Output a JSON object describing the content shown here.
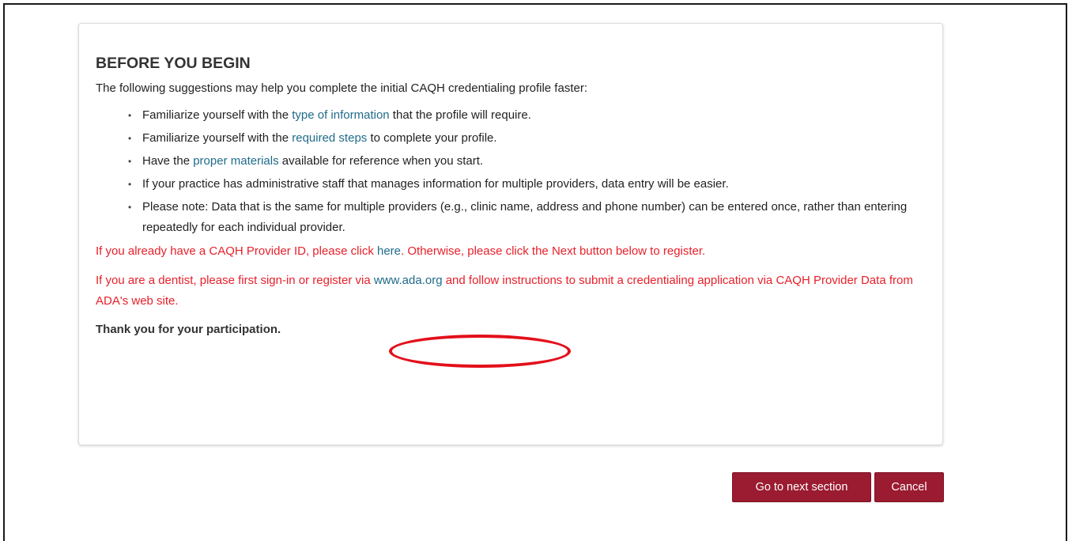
{
  "card": {
    "title": "BEFORE YOU BEGIN",
    "intro": "The following suggestions may help you complete the initial CAQH credentialing profile faster:",
    "tips": [
      {
        "pre": "Familiarize yourself with the ",
        "link": "type of information",
        "post": " that the profile will require."
      },
      {
        "pre": "Familiarize yourself with the ",
        "link": "required steps",
        "post": " to complete your profile."
      },
      {
        "pre": "Have the ",
        "link": "proper materials",
        "post": " available for reference when you start."
      },
      {
        "pre": "If your practice has administrative staff that manages information for multiple providers, data entry will be easier.",
        "link": "",
        "post": ""
      },
      {
        "pre": "Please note: Data that is the same for multiple providers (e.g., clinic name, address and phone number) can be entered once, rather than entering repeatedly for each individual provider.",
        "link": "",
        "post": ""
      }
    ],
    "bullet": "•",
    "provider_id_notice": {
      "pre": "If you already have a CAQH Provider ID, please click ",
      "link": "here",
      "post": ". Otherwise, please click the Next button below to register."
    },
    "dentist_notice": {
      "pre": "If you are a dentist, please first sign-in or register via ",
      "link": "www.ada.org",
      "post": " and follow instructions to submit a credentialing application via CAQH Provider Data from ADA's web site."
    },
    "thanks": "Thank you for your participation."
  },
  "actions": {
    "next_label": "Go to next section",
    "cancel_label": "Cancel"
  },
  "colors": {
    "link": "#1f6b8a",
    "notice_red": "#e8202a",
    "button_bg": "#9b1b30",
    "annotation_red": "#e3101b"
  }
}
